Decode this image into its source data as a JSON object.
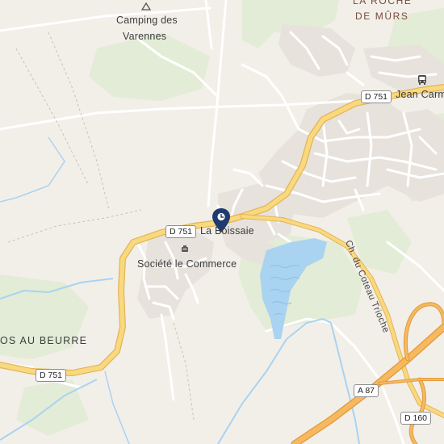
{
  "places": {
    "camping_line1": "Camping des",
    "camping_line2": "Varennes",
    "roche_line1": "LA ROCHE",
    "roche_line2": "DE MÛRS",
    "jean_carmet": "Jean Carme",
    "la_boissaie": "La Boissaie",
    "societe": "Société le Commerce",
    "os_au_beurre": "OS AU BEURRE"
  },
  "roads": {
    "d751_east": "D 751",
    "d751_center": "D 751",
    "d751_west": "D 751",
    "a87": "A 87",
    "d160": "D 160",
    "coteau": "Ch. du Coteau Trioche"
  },
  "icons": [
    "campground-icon",
    "bus-stop-icon",
    "map-pin-icon",
    "restaurant-icon"
  ],
  "colors": {
    "land": "#f2efe9",
    "green": "#e3ecd6",
    "water": "#a9d3f1",
    "road_major": "#f6cf6b",
    "road_major_casing": "#e4b455",
    "motorway": "#f2b257",
    "pin": "#1f3a6e"
  }
}
